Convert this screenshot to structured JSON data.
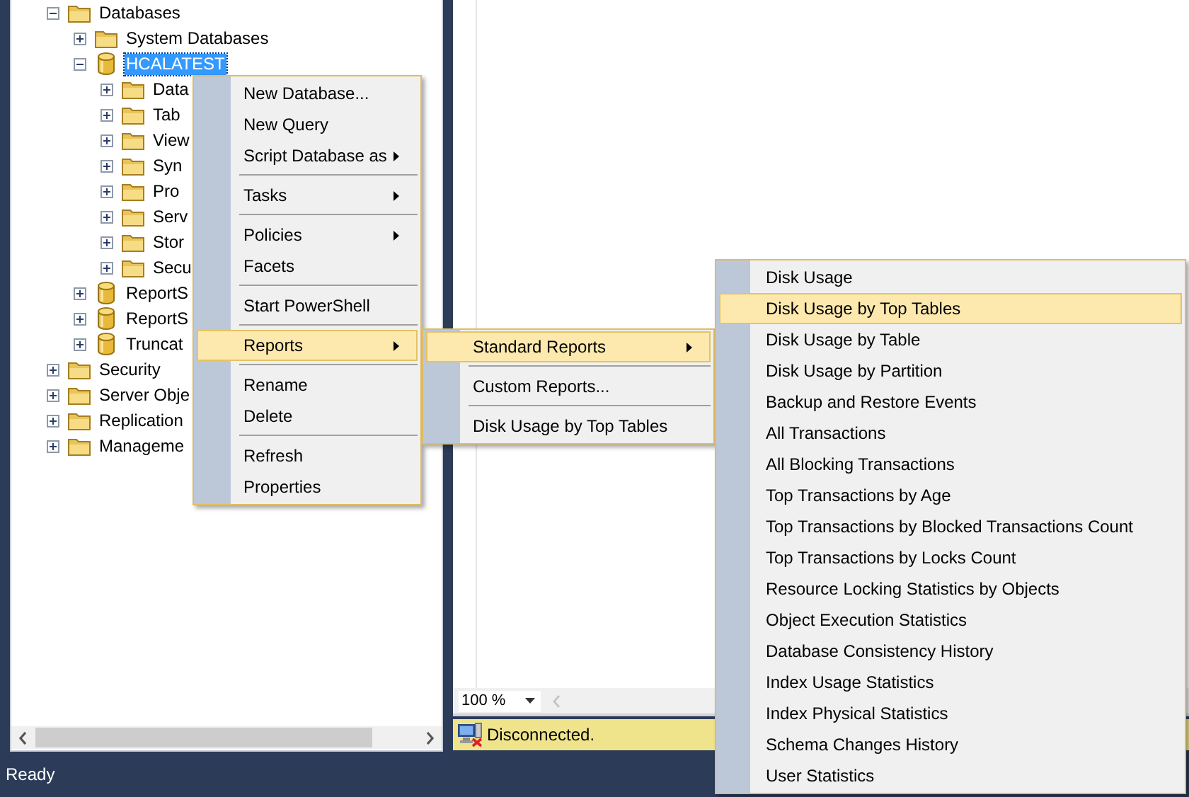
{
  "tree": [
    {
      "label": "Databases",
      "kind": "folder",
      "expanded": true,
      "selected": false,
      "children": [
        {
          "label": "System Databases",
          "kind": "folder",
          "expanded": false,
          "selected": false
        },
        {
          "label": "HCALATEST",
          "kind": "database",
          "expanded": true,
          "selected": true,
          "children": [
            {
              "label": "Data",
              "kind": "folder",
              "expanded": false,
              "selected": false
            },
            {
              "label": "Tab",
              "kind": "folder",
              "expanded": false,
              "selected": false
            },
            {
              "label": "View",
              "kind": "folder",
              "expanded": false,
              "selected": false
            },
            {
              "label": "Syn",
              "kind": "folder",
              "expanded": false,
              "selected": false
            },
            {
              "label": "Pro",
              "kind": "folder",
              "expanded": false,
              "selected": false
            },
            {
              "label": "Serv",
              "kind": "folder",
              "expanded": false,
              "selected": false
            },
            {
              "label": "Stor",
              "kind": "folder",
              "expanded": false,
              "selected": false
            },
            {
              "label": "Secu",
              "kind": "folder",
              "expanded": false,
              "selected": false
            }
          ]
        },
        {
          "label": "ReportS",
          "kind": "database",
          "expanded": false,
          "selected": false
        },
        {
          "label": "ReportS",
          "kind": "database",
          "expanded": false,
          "selected": false
        },
        {
          "label": "Truncat",
          "kind": "database",
          "expanded": false,
          "selected": false
        }
      ]
    },
    {
      "label": "Security",
      "kind": "folder",
      "expanded": false,
      "selected": false
    },
    {
      "label": "Server Obje",
      "kind": "folder",
      "expanded": false,
      "selected": false
    },
    {
      "label": "Replication",
      "kind": "folder",
      "expanded": false,
      "selected": false
    },
    {
      "label": "Manageme",
      "kind": "folder",
      "expanded": false,
      "selected": false
    }
  ],
  "menus": [
    {
      "items": [
        {
          "kind": "item",
          "label": "New Database...",
          "has_submenu": false,
          "selected": false
        },
        {
          "kind": "item",
          "label": "New Query",
          "has_submenu": false,
          "selected": false
        },
        {
          "kind": "item",
          "label": "Script Database as",
          "has_submenu": true,
          "selected": false
        },
        {
          "kind": "separator"
        },
        {
          "kind": "item",
          "label": "Tasks",
          "has_submenu": true,
          "selected": false
        },
        {
          "kind": "separator"
        },
        {
          "kind": "item",
          "label": "Policies",
          "has_submenu": true,
          "selected": false
        },
        {
          "kind": "item",
          "label": "Facets",
          "has_submenu": false,
          "selected": false
        },
        {
          "kind": "separator"
        },
        {
          "kind": "item",
          "label": "Start PowerShell",
          "has_submenu": false,
          "selected": false
        },
        {
          "kind": "separator"
        },
        {
          "kind": "item",
          "label": "Reports",
          "has_submenu": true,
          "selected": true
        },
        {
          "kind": "separator"
        },
        {
          "kind": "item",
          "label": "Rename",
          "has_submenu": false,
          "selected": false
        },
        {
          "kind": "item",
          "label": "Delete",
          "has_submenu": false,
          "selected": false
        },
        {
          "kind": "separator"
        },
        {
          "kind": "item",
          "label": "Refresh",
          "has_submenu": false,
          "selected": false
        },
        {
          "kind": "item",
          "label": "Properties",
          "has_submenu": false,
          "selected": false
        }
      ]
    },
    {
      "items": [
        {
          "kind": "item",
          "label": "Standard Reports",
          "has_submenu": true,
          "selected": true
        },
        {
          "kind": "separator"
        },
        {
          "kind": "item",
          "label": "Custom Reports...",
          "has_submenu": false,
          "selected": false
        },
        {
          "kind": "separator"
        },
        {
          "kind": "item",
          "label": "Disk Usage by Top Tables",
          "has_submenu": false,
          "selected": false
        }
      ]
    },
    {
      "items": [
        {
          "kind": "item",
          "label": "Disk Usage",
          "has_submenu": false,
          "selected": false
        },
        {
          "kind": "item",
          "label": "Disk Usage by Top Tables",
          "has_submenu": false,
          "selected": true
        },
        {
          "kind": "item",
          "label": "Disk Usage by Table",
          "has_submenu": false,
          "selected": false
        },
        {
          "kind": "item",
          "label": "Disk Usage by Partition",
          "has_submenu": false,
          "selected": false
        },
        {
          "kind": "item",
          "label": "Backup and Restore Events",
          "has_submenu": false,
          "selected": false
        },
        {
          "kind": "item",
          "label": "All Transactions",
          "has_submenu": false,
          "selected": false
        },
        {
          "kind": "item",
          "label": "All Blocking Transactions",
          "has_submenu": false,
          "selected": false
        },
        {
          "kind": "item",
          "label": "Top Transactions by Age",
          "has_submenu": false,
          "selected": false
        },
        {
          "kind": "item",
          "label": "Top Transactions by Blocked Transactions Count",
          "has_submenu": false,
          "selected": false
        },
        {
          "kind": "item",
          "label": "Top Transactions by Locks Count",
          "has_submenu": false,
          "selected": false
        },
        {
          "kind": "item",
          "label": "Resource Locking Statistics by Objects",
          "has_submenu": false,
          "selected": false
        },
        {
          "kind": "item",
          "label": "Object Execution Statistics",
          "has_submenu": false,
          "selected": false
        },
        {
          "kind": "item",
          "label": "Database Consistency History",
          "has_submenu": false,
          "selected": false
        },
        {
          "kind": "item",
          "label": "Index Usage Statistics",
          "has_submenu": false,
          "selected": false
        },
        {
          "kind": "item",
          "label": "Index Physical Statistics",
          "has_submenu": false,
          "selected": false
        },
        {
          "kind": "item",
          "label": "Schema Changes History",
          "has_submenu": false,
          "selected": false
        },
        {
          "kind": "item",
          "label": "User Statistics",
          "has_submenu": false,
          "selected": false
        }
      ]
    }
  ],
  "zoom": {
    "value": "100 %"
  },
  "connection_status": {
    "text": "Disconnected."
  },
  "status_bar": {
    "text": "Ready"
  }
}
